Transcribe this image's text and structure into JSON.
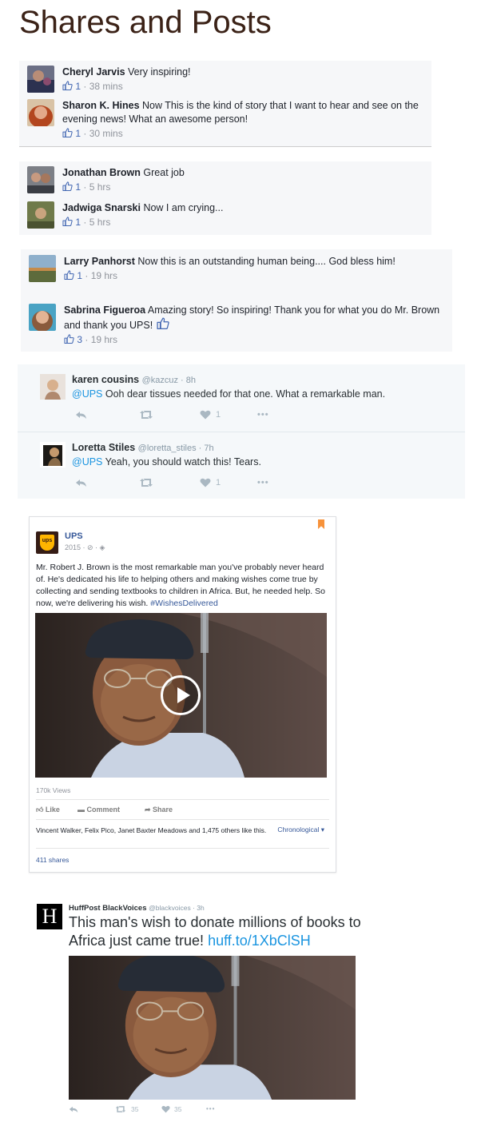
{
  "page_title": "Shares and Posts",
  "fb_groups": [
    {
      "comments": [
        {
          "name": "Cheryl Jarvis",
          "text": "Very inspiring!",
          "likes": "1",
          "time": "38 mins"
        },
        {
          "name": "Sharon K. Hines",
          "text": "Now This is the kind of story that I want to hear and see on the evening news! What an awesome person!",
          "likes": "1",
          "time": "30 mins"
        }
      ]
    },
    {
      "comments": [
        {
          "name": "Jonathan Brown",
          "text": "Great job",
          "likes": "1",
          "time": "5 hrs"
        },
        {
          "name": "Jadwiga Snarski",
          "text": "Now I am crying...",
          "likes": "1",
          "time": "5 hrs"
        }
      ]
    },
    {
      "comments": [
        {
          "name": "Larry Panhorst",
          "text": "Now this is an outstanding human being.... God bless him!",
          "likes": "1",
          "time": "19 hrs"
        },
        {
          "name": "Sabrina Figueroa",
          "text": "Amazing story! So inspiring! Thank you for what you do Mr. Brown and thank you UPS!",
          "likes": "3",
          "time": "19 hrs"
        }
      ]
    }
  ],
  "tweets": [
    {
      "name": "karen cousins",
      "handle": "@kazcuz",
      "time": "8h",
      "mention": "@UPS",
      "text": " Ooh dear tissues needed for that one. What a remarkable man.",
      "likes": "1"
    },
    {
      "name": "Loretta Stiles",
      "handle": "@loretta_stiles",
      "time": "7h",
      "mention": "@UPS",
      "text": " Yeah, you should watch this! Tears.",
      "likes": "1"
    }
  ],
  "ups_post": {
    "page_name": "UPS",
    "logo_text": "ups",
    "date": "2015 · ⊘ · ◈",
    "text": "Mr. Robert J. Brown is the most remarkable man you've probably never heard of. He's dedicated his life to helping others and making wishes come true by collecting and sending textbooks to children in Africa. But, he needed help. So now, we're delivering his wish. ",
    "hashtag": "#WishesDelivered",
    "views": "170k Views",
    "like_label": "Like",
    "comment_label": "Comment",
    "share_label": "Share",
    "likers": "Vincent Walker, Felix Pico, Janet Baxter Meadows and 1,475 others like this.",
    "sort_label": "Chronological ▾",
    "shares": "411 shares"
  },
  "huffpost_tweet": {
    "logo_letter": "H",
    "name": "HuffPost BlackVoices",
    "handle": "@blackvoices",
    "time": "3h",
    "text": "This man's wish to donate millions of books to Africa just came true! ",
    "link": "huff.to/1XbClSH",
    "retweets": "35",
    "likes": "35"
  },
  "colors": {
    "fb_link": "#4267b2",
    "twitter_blue": "#1b95e0",
    "ups_brown": "#351c15",
    "ups_gold": "#ffb500",
    "title_brown": "#3b2217"
  }
}
